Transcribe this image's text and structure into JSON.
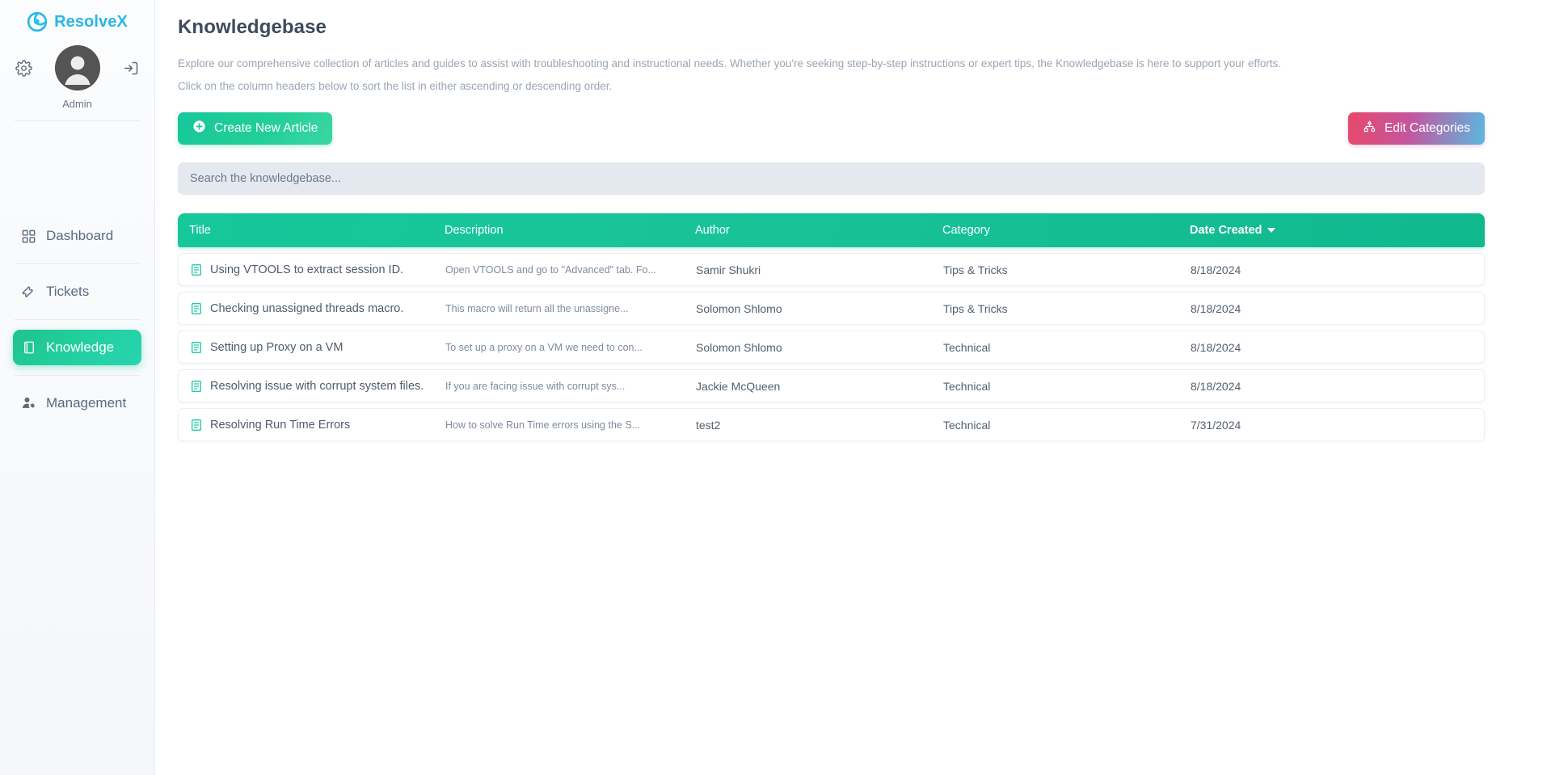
{
  "brand": {
    "name": "ResolveX",
    "logo_icon": "resolvex-swirl-logo"
  },
  "sidebar": {
    "settings_icon": "gear-icon",
    "logout_icon": "logout-icon",
    "avatar_icon": "user-avatar",
    "user_name": "Admin",
    "items": [
      {
        "label": "Dashboard",
        "icon": "grid-dashboard-icon",
        "active": false
      },
      {
        "label": "Tickets",
        "icon": "ticket-icon",
        "active": false
      },
      {
        "label": "Knowledge",
        "icon": "book-icon",
        "active": true
      },
      {
        "label": "Management",
        "icon": "user-settings-icon",
        "active": false
      }
    ]
  },
  "page": {
    "title": "Knowledgebase",
    "description_line1": "Explore our comprehensive collection of articles and guides to assist with troubleshooting and instructional needs. Whether you're seeking step-by-step instructions or expert tips, the Knowledgebase is here to support your efforts.",
    "description_line2": "Click on the column headers below to sort the list in either ascending or descending order."
  },
  "toolbar": {
    "create_label": "Create New Article",
    "create_icon": "plus-circle-icon",
    "edit_categories_label": "Edit Categories",
    "edit_categories_icon": "hierarchy-icon",
    "create_color": "#16c79a"
  },
  "search": {
    "placeholder": "Search the knowledgebase...",
    "value": ""
  },
  "table": {
    "columns": [
      {
        "label": "Title",
        "sorted": false
      },
      {
        "label": "Description",
        "sorted": false
      },
      {
        "label": "Author",
        "sorted": false
      },
      {
        "label": "Category",
        "sorted": false
      },
      {
        "label": "Date Created",
        "sorted": true,
        "sort_direction": "desc"
      }
    ],
    "row_icon": "article-document-icon",
    "rows": [
      {
        "title": "Using VTOOLS to extract session ID.",
        "description": "Open VTOOLS and go to \"Advanced\" tab. Fo...",
        "author": "Samir Shukri",
        "category": "Tips & Tricks",
        "date_created": "8/18/2024"
      },
      {
        "title": "Checking unassigned threads macro.",
        "description": "This macro will return all the unassigne...",
        "author": "Solomon Shlomo",
        "category": "Tips & Tricks",
        "date_created": "8/18/2024"
      },
      {
        "title": "Setting up Proxy on a VM",
        "description": "To set up a proxy on a VM we need to con...",
        "author": "Solomon Shlomo",
        "category": "Technical",
        "date_created": "8/18/2024"
      },
      {
        "title": "Resolving issue with corrupt system files.",
        "description": "If you are facing issue with corrupt sys...",
        "author": "Jackie McQueen",
        "category": "Technical",
        "date_created": "8/18/2024"
      },
      {
        "title": "Resolving Run Time Errors",
        "description": "How to solve Run Time errors using the S...",
        "author": "test2",
        "category": "Technical",
        "date_created": "7/31/2024"
      }
    ]
  }
}
